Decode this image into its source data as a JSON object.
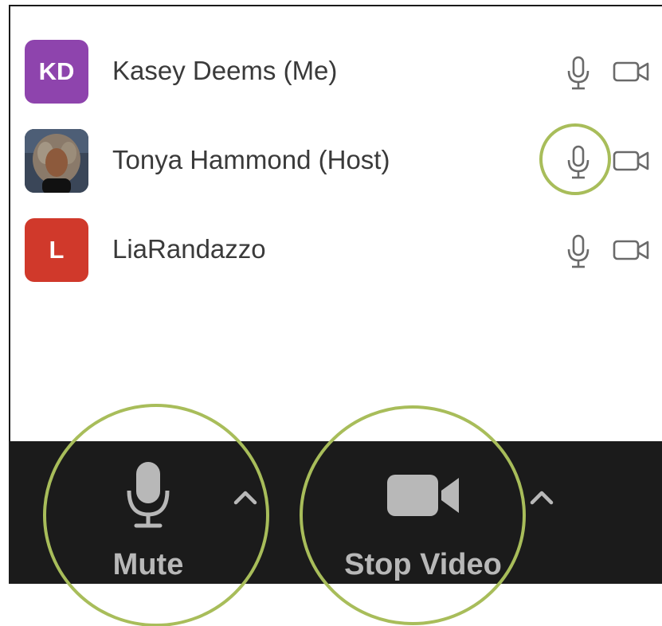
{
  "participants": [
    {
      "initials": "KD",
      "name": "Kasey Deems (Me)",
      "avatar_color": "#8e44ad",
      "avatar_type": "initials"
    },
    {
      "initials": "",
      "name": "Tonya Hammond (Host)",
      "avatar_color": "#2a3544",
      "avatar_type": "photo"
    },
    {
      "initials": "L",
      "name": "LiaRandazzo",
      "avatar_color": "#d0392b",
      "avatar_type": "initials"
    }
  ],
  "toolbar": {
    "mute_label": "Mute",
    "video_label": "Stop Video"
  },
  "icons": {
    "participant_mic": "microphone-icon",
    "participant_camera": "video-camera-icon",
    "toolbar_mic": "microphone-icon",
    "toolbar_camera": "video-camera-icon",
    "options": "chevron-up-icon"
  },
  "colors": {
    "highlight_circle": "#a8bd5a",
    "toolbar_bg": "#1b1b1b",
    "toolbar_icon": "#b8b8b8",
    "list_icon": "#6a6a6a"
  }
}
